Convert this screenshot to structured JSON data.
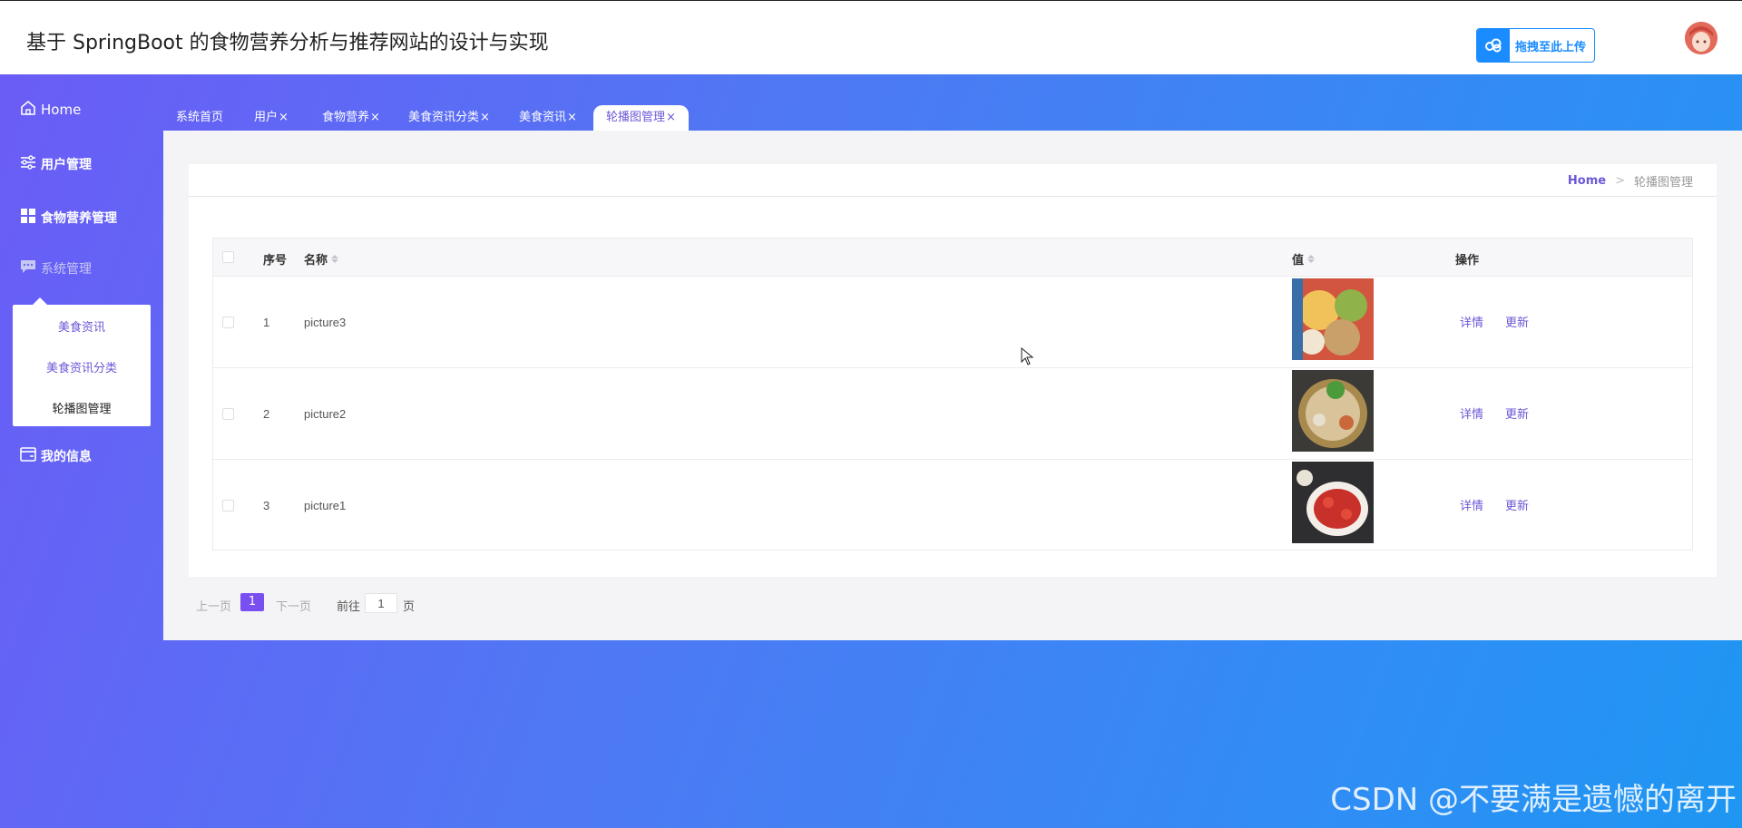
{
  "header": {
    "title": "基于 SpringBoot 的食物营养分析与推荐网站的设计与实现",
    "upload_label": "拖拽至此上传"
  },
  "sidebar": {
    "home": "Home",
    "items": [
      {
        "label": "用户管理",
        "icon": "sliders-icon"
      },
      {
        "label": "食物营养管理",
        "icon": "grid-icon"
      },
      {
        "label": "系统管理",
        "icon": "chat-icon"
      },
      {
        "label": "我的信息",
        "icon": "card-icon"
      }
    ],
    "submenu": [
      "美食资讯",
      "美食资讯分类",
      "轮播图管理"
    ]
  },
  "tabs": [
    "系统首页",
    "用户",
    "食物营养",
    "美食资讯分类",
    "美食资讯",
    "轮播图管理"
  ],
  "tab_close": "×",
  "breadcrumb": {
    "home": "Home",
    "separator": ">",
    "current": "轮播图管理"
  },
  "table": {
    "columns": [
      "序号",
      "名称",
      "值",
      "操作"
    ],
    "rows": [
      {
        "index": "1",
        "name": "picture3"
      },
      {
        "index": "2",
        "name": "picture2"
      },
      {
        "index": "3",
        "name": "picture1"
      }
    ],
    "actions": [
      "详情",
      "更新"
    ]
  },
  "pagination": {
    "prev": "上一页",
    "current": "1",
    "next": "下一页",
    "goto_prefix": "前往",
    "goto_value": "1",
    "goto_suffix": "页"
  },
  "watermark": "CSDN @不要满是遗憾的离开",
  "colors": {
    "accent": "#6a58d6",
    "upload": "#1a8cff",
    "page_active": "#7a4ff2"
  }
}
